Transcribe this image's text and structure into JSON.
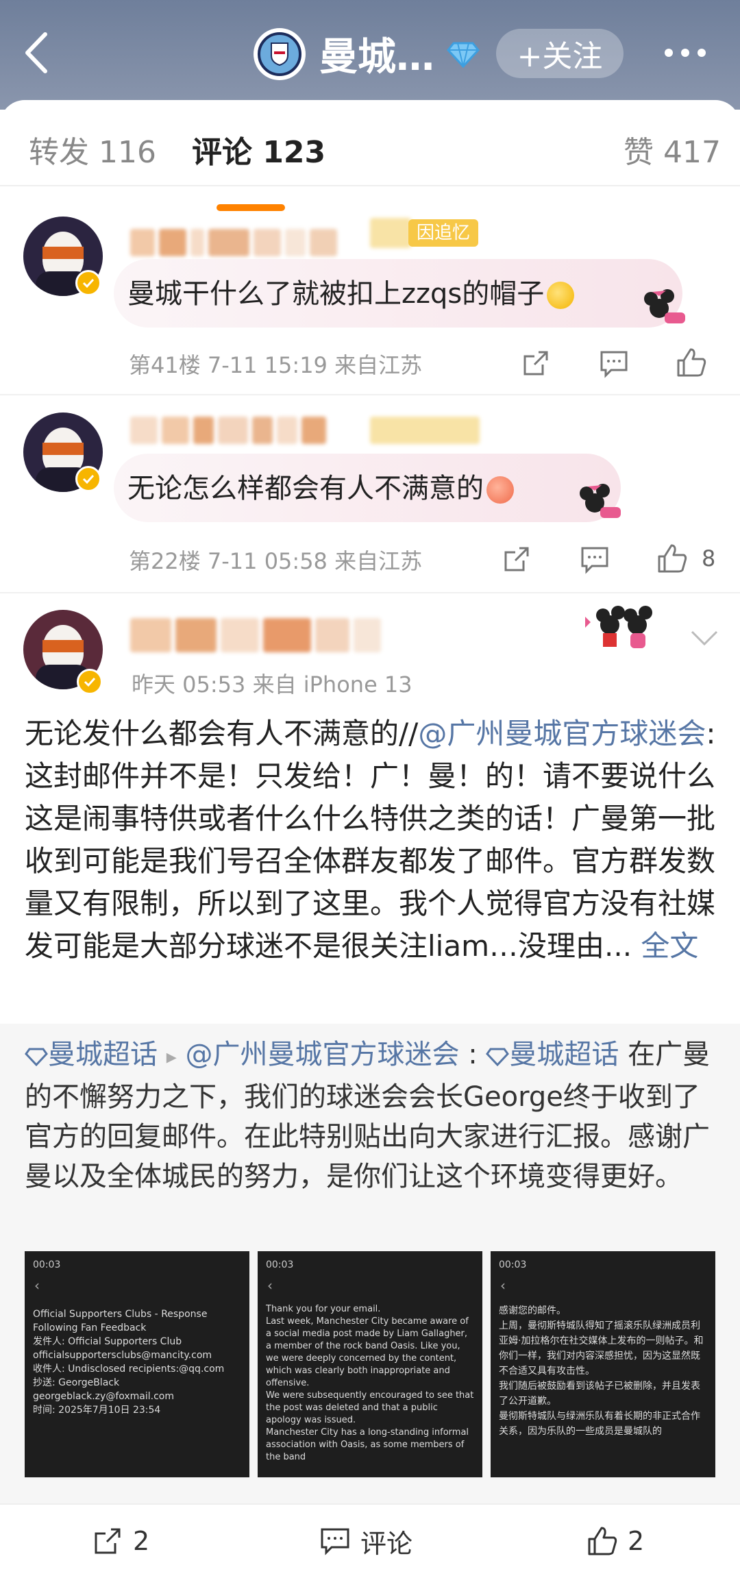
{
  "header": {
    "title": "曼城…",
    "follow_label": "+关注"
  },
  "tabs": [
    {
      "label": "转发 116"
    },
    {
      "label": "评论 123"
    },
    {
      "label": "赞 417"
    }
  ],
  "comments": [
    {
      "tag": "因追忆",
      "text": "曼城干什么了就被扣上zzqs的帽子",
      "meta": "第41楼  7-11 15:19  来自江苏",
      "likes": ""
    },
    {
      "text": "无论怎么样都会有人不满意的",
      "meta": "第22楼  7-11 05:58  来自江苏",
      "likes": "8"
    }
  ],
  "post": {
    "meta": "昨天 05:53   来自 iPhone 13",
    "text_a": "无论发什么都会有人不满意的//",
    "mention": "@广州曼城官方球迷会",
    "text_b": ":这封邮件并不是！只发给！广！曼！的！请不要说什么这是闹事特供或者什么什么特供之类的话！广曼第一批收到可能是我们号召全体群友都发了邮件。官方群发数量又有限制，所以到了这里。我个人觉得官方没有社媒发可能是大部分球迷不是很关注liam…没理由...",
    "full_text_link": "全文"
  },
  "quote": {
    "topic": "曼城超话",
    "arrow": "▸",
    "author": "@广州曼城官方球迷会",
    "colon": " :",
    "topic2": "曼城超话",
    "text": " 在广曼的不懈努力之下，我们的球迷会会长George终于收到了官方的回复邮件。在此特别贴出向大家进行汇报。感谢广曼以及全体城民的努力，是你们让这个环境变得更好。"
  },
  "thumbnails": [
    {
      "status": "00:03",
      "lines": "Official Supporters Clubs - Response Following Fan Feedback\n发件人: Official Supporters Club  officialsupportersclubs@mancity.com\n收件人: Undisclosed recipients:@qq.com\n抄送: GeorgeBlack georgeblack.zy@foxmail.com\n时间: 2025年7月10日 23:54"
    },
    {
      "status": "00:03",
      "lines": "Thank you for your email.\nLast week, Manchester City became aware of a social media post made by Liam Gallagher, a member of the rock band Oasis. Like you, we were deeply concerned by the content, which was clearly both inappropriate and offensive.\nWe were subsequently encouraged to see that the post was deleted and that a public apology was issued.\nManchester City has a long-standing informal association with Oasis, as some members of the band"
    },
    {
      "status": "00:03",
      "lines": "感谢您的邮件。\n上周，曼彻斯特城队得知了摇滚乐队绿洲成员利亚姆·加拉格尔在社交媒体上发布的一则帖子。和你们一样，我们对内容深感担忧，因为这显然既不合适又具有攻击性。\n我们随后被鼓励看到该帖子已被删除，并且发表了公开道歉。\n曼彻斯特城队与绿洲乐队有着长期的非正式合作关系，因为乐队的一些成员是曼城队的"
    }
  ],
  "bottom_bar": {
    "repost_count": "2",
    "comment_label": "评论",
    "like_count": "2"
  },
  "colors": {
    "accent": "#ff8200",
    "link": "#5676a5",
    "header_bg": "#7a88a2"
  }
}
